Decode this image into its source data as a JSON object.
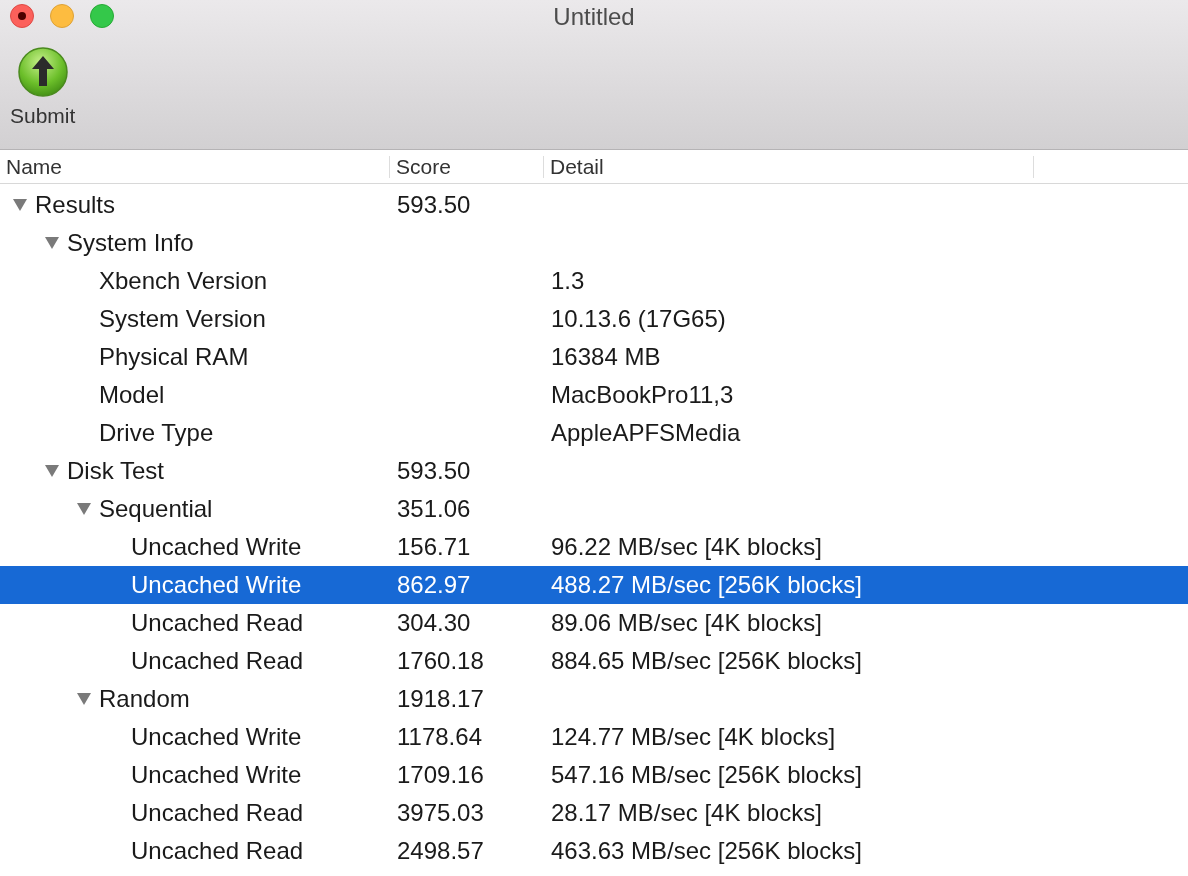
{
  "window": {
    "title": "Untitled"
  },
  "toolbar": {
    "items": [
      {
        "label": "Submit"
      }
    ]
  },
  "table": {
    "columns": [
      "Name",
      "Score",
      "Detail"
    ],
    "rows": [
      {
        "name": "Results",
        "score": "593.50",
        "expanded": true,
        "selected": false,
        "children": [
          {
            "name": "System Info",
            "expanded": true,
            "selected": false,
            "children": [
              {
                "name": "Xbench Version",
                "detail": "1.3",
                "selected": false
              },
              {
                "name": "System Version",
                "detail": "10.13.6 (17G65)",
                "selected": false
              },
              {
                "name": "Physical RAM",
                "detail": "16384 MB",
                "selected": false
              },
              {
                "name": "Model",
                "detail": "MacBookPro11,3",
                "selected": false
              },
              {
                "name": "Drive Type",
                "detail": "AppleAPFSMedia",
                "selected": false
              }
            ]
          },
          {
            "name": "Disk Test",
            "score": "593.50",
            "expanded": true,
            "selected": false,
            "children": [
              {
                "name": "Sequential",
                "score": "351.06",
                "expanded": true,
                "selected": false,
                "children": [
                  {
                    "name": "Uncached Write",
                    "score": "156.71",
                    "detail": "96.22 MB/sec [4K blocks]",
                    "selected": false
                  },
                  {
                    "name": "Uncached Write",
                    "score": "862.97",
                    "detail": "488.27 MB/sec [256K blocks]",
                    "selected": true
                  },
                  {
                    "name": "Uncached Read",
                    "score": "304.30",
                    "detail": "89.06 MB/sec [4K blocks]",
                    "selected": false
                  },
                  {
                    "name": "Uncached Read",
                    "score": "1760.18",
                    "detail": "884.65 MB/sec [256K blocks]",
                    "selected": false
                  }
                ]
              },
              {
                "name": "Random",
                "score": "1918.17",
                "expanded": true,
                "selected": false,
                "children": [
                  {
                    "name": "Uncached Write",
                    "score": "1178.64",
                    "detail": "124.77 MB/sec [4K blocks]",
                    "selected": false
                  },
                  {
                    "name": "Uncached Write",
                    "score": "1709.16",
                    "detail": "547.16 MB/sec [256K blocks]",
                    "selected": false
                  },
                  {
                    "name": "Uncached Read",
                    "score": "3975.03",
                    "detail": "28.17 MB/sec [4K blocks]",
                    "selected": false
                  },
                  {
                    "name": "Uncached Read",
                    "score": "2498.57",
                    "detail": "463.63 MB/sec [256K blocks]",
                    "selected": false
                  }
                ]
              }
            ]
          }
        ]
      }
    ]
  }
}
